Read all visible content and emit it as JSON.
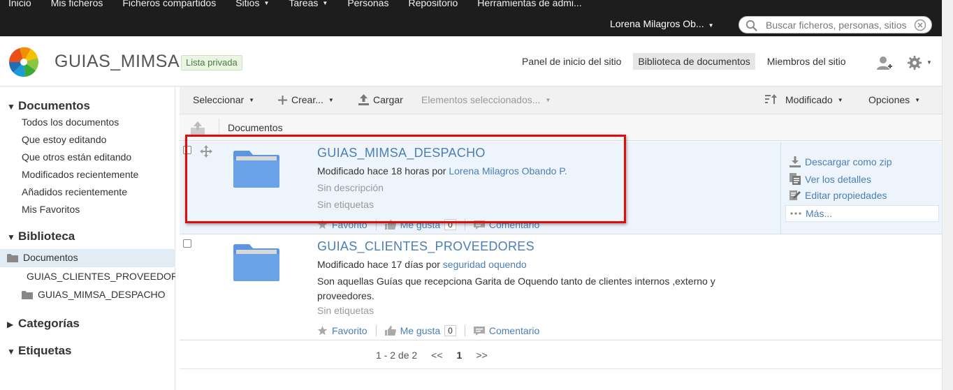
{
  "topbar": {
    "nav": [
      {
        "label": "Inicio",
        "has_menu": false
      },
      {
        "label": "Mis ficheros",
        "has_menu": false
      },
      {
        "label": "Ficheros compartidos",
        "has_menu": false
      },
      {
        "label": "Sitios",
        "has_menu": true
      },
      {
        "label": "Tareas",
        "has_menu": true
      },
      {
        "label": "Personas",
        "has_menu": false
      },
      {
        "label": "Repositorio",
        "has_menu": false
      },
      {
        "label": "Herramientas de admi...",
        "has_menu": false
      }
    ],
    "user_name": "Lorena Milagros Ob...",
    "search_placeholder": "Buscar ficheros, personas, sitios"
  },
  "site": {
    "title": "GUIAS_MIMSA",
    "visibility": "Lista privada",
    "nav": {
      "dashboard": "Panel de inicio del sitio",
      "library": "Biblioteca de documentos",
      "members": "Miembros del sitio"
    }
  },
  "sidebar": {
    "documents_heading": "Documentos",
    "filters": [
      "Todos los documentos",
      "Que estoy editando",
      "Que otros están editando",
      "Modificados recientemente",
      "Añadidos recientemente",
      "Mis Favoritos"
    ],
    "library_heading": "Biblioteca",
    "tree_root": "Documentos",
    "tree_children": [
      "GUIAS_CLIENTES_PROVEEDORES",
      "GUIAS_MIMSA_DESPACHO"
    ],
    "categories_heading": "Categorías",
    "tags_heading": "Etiquetas"
  },
  "toolbar": {
    "select": "Seleccionar",
    "create": "Crear...",
    "upload": "Cargar",
    "selected_items": "Elementos seleccionados...",
    "sort": "Modificado",
    "options": "Opciones"
  },
  "breadcrumb": {
    "current": "Documentos"
  },
  "rows": [
    {
      "name": "GUIAS_MIMSA_DESPACHO",
      "modified_prefix": "Modificado hace 18 horas por",
      "modified_by": "Lorena Milagros Obando P.",
      "description": "Sin descripción",
      "tags": "Sin etiquetas",
      "favorite": "Favorito",
      "like": "Me gusta",
      "like_count": "0",
      "comment": "Comentario"
    },
    {
      "name": "GUIAS_CLIENTES_PROVEEDORES",
      "modified_prefix": "Modificado hace 17 días por",
      "modified_by": "seguridad oquendo",
      "description": "Son aquellas Guías que recepciona Garita de Oquendo tanto de clientes internos ,externo y proveedores.",
      "tags": "Sin etiquetas",
      "favorite": "Favorito",
      "like": "Me gusta",
      "like_count": "0",
      "comment": "Comentario"
    }
  ],
  "row_actions": {
    "download_zip": "Descargar como zip",
    "view_details": "Ver los detalles",
    "edit_properties": "Editar propiedades",
    "more": "Más..."
  },
  "paginator": {
    "summary": "1 - 2 de 2",
    "prev": "<<",
    "current": "1",
    "next": ">>"
  },
  "colors": {
    "link": "#4a7fb5",
    "topbar": "#1d1d1d",
    "highlight": "#e10b0b",
    "folder": "#6aa2e8"
  }
}
